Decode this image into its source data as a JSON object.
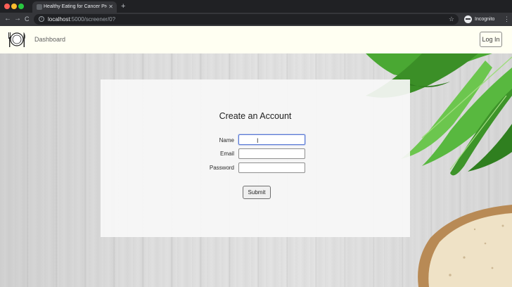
{
  "browser": {
    "tab_title": "Healthy Eating for Cancer Pre",
    "tab_close": "✕",
    "new_tab": "+",
    "url_host": "localhost",
    "url_path": ":5000/screener/0?",
    "back": "←",
    "forward": "→",
    "reload": "C",
    "star": "☆",
    "incognito_label": "Incognito",
    "menu": "⋮",
    "icons": {
      "traffic": [
        "red",
        "yellow",
        "green"
      ],
      "info": "info-icon",
      "bookmark": "star-icon",
      "profile": "incognito-icon"
    }
  },
  "header": {
    "nav_link": "Dashboard",
    "login_label": "Log In",
    "logo_icon": "plate-utensils-icon"
  },
  "form": {
    "title": "Create an Account",
    "name_label": "Name",
    "email_label": "Email",
    "password_label": "Password",
    "name_value": "",
    "email_value": "",
    "password_value": "",
    "submit_label": "Submit",
    "cursor": "I"
  },
  "colors": {
    "header_bg": "#fffff2",
    "card_bg": "#f7f7f7",
    "leaf_green": "#3f9a2c",
    "bread_crust": "#b88a55"
  }
}
